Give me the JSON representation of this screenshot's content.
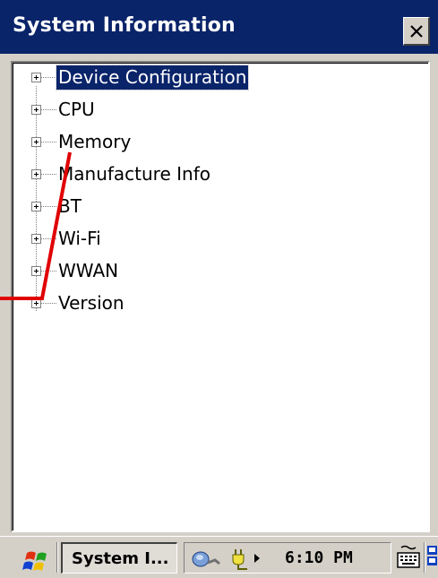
{
  "window": {
    "title": "System Information",
    "close_glyph": "close-icon"
  },
  "tree": {
    "items": [
      {
        "label": "Device Configuration",
        "selected": true
      },
      {
        "label": "CPU"
      },
      {
        "label": "Memory"
      },
      {
        "label": "Manufacture Info"
      },
      {
        "label": "BT"
      },
      {
        "label": "Wi-Fi"
      },
      {
        "label": "WWAN"
      },
      {
        "label": "Version"
      }
    ]
  },
  "taskbar": {
    "start_icon": "windows-flag-icon",
    "task_button_label": "System I...",
    "clock": "6:10 PM",
    "tray_icons": [
      "network-icon",
      "power-plug-icon",
      "tray-arrow-icon",
      "keyboard-icon",
      "desktop-icon"
    ]
  },
  "colors": {
    "titlebar": "#0a246a",
    "selection": "#0a246a",
    "annotation": "#e00000",
    "face": "#d4d0c8"
  }
}
